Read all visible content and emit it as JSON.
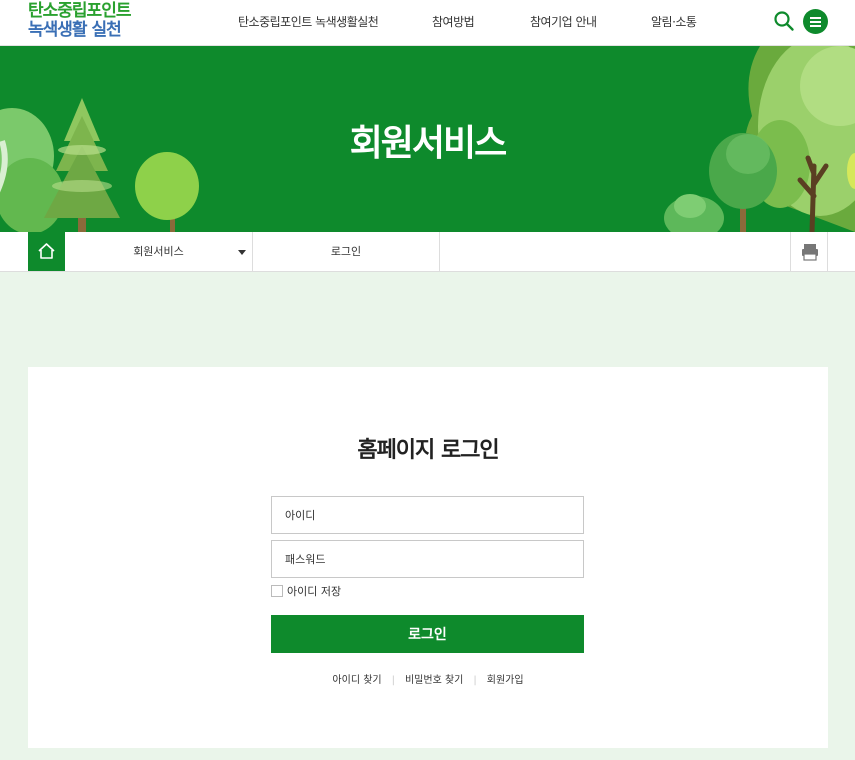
{
  "header": {
    "logo_line1": "탄소중립포인트",
    "logo_line2": "녹색생활 실천",
    "nav": [
      {
        "label": "탄소중립포인트 녹색생활실천"
      },
      {
        "label": "참여방법"
      },
      {
        "label": "참여기업 안내"
      },
      {
        "label": "알림·소통"
      }
    ],
    "search_icon": "search-icon",
    "menu_icon": "hamburger-menu-icon"
  },
  "hero": {
    "title": "회원서비스"
  },
  "location": {
    "home_icon": "home-icon",
    "depth1": "회원서비스",
    "depth2": "로그인",
    "print_icon": "printer-icon"
  },
  "login": {
    "title": "홈페이지 로그인",
    "id_placeholder": "아이디",
    "password_placeholder": "패스워드",
    "save_id_label": "아이디 저장",
    "save_id_checked": false,
    "submit_label": "로그인",
    "links": {
      "find_id": "아이디 찾기",
      "find_password": "비밀번호 찾기",
      "signup": "회원가입"
    }
  },
  "colors": {
    "brand_green": "#0e8a2c",
    "logo_green": "#2aa12f",
    "logo_blue": "#3a6fb5",
    "page_bg": "#eaf5ea"
  }
}
